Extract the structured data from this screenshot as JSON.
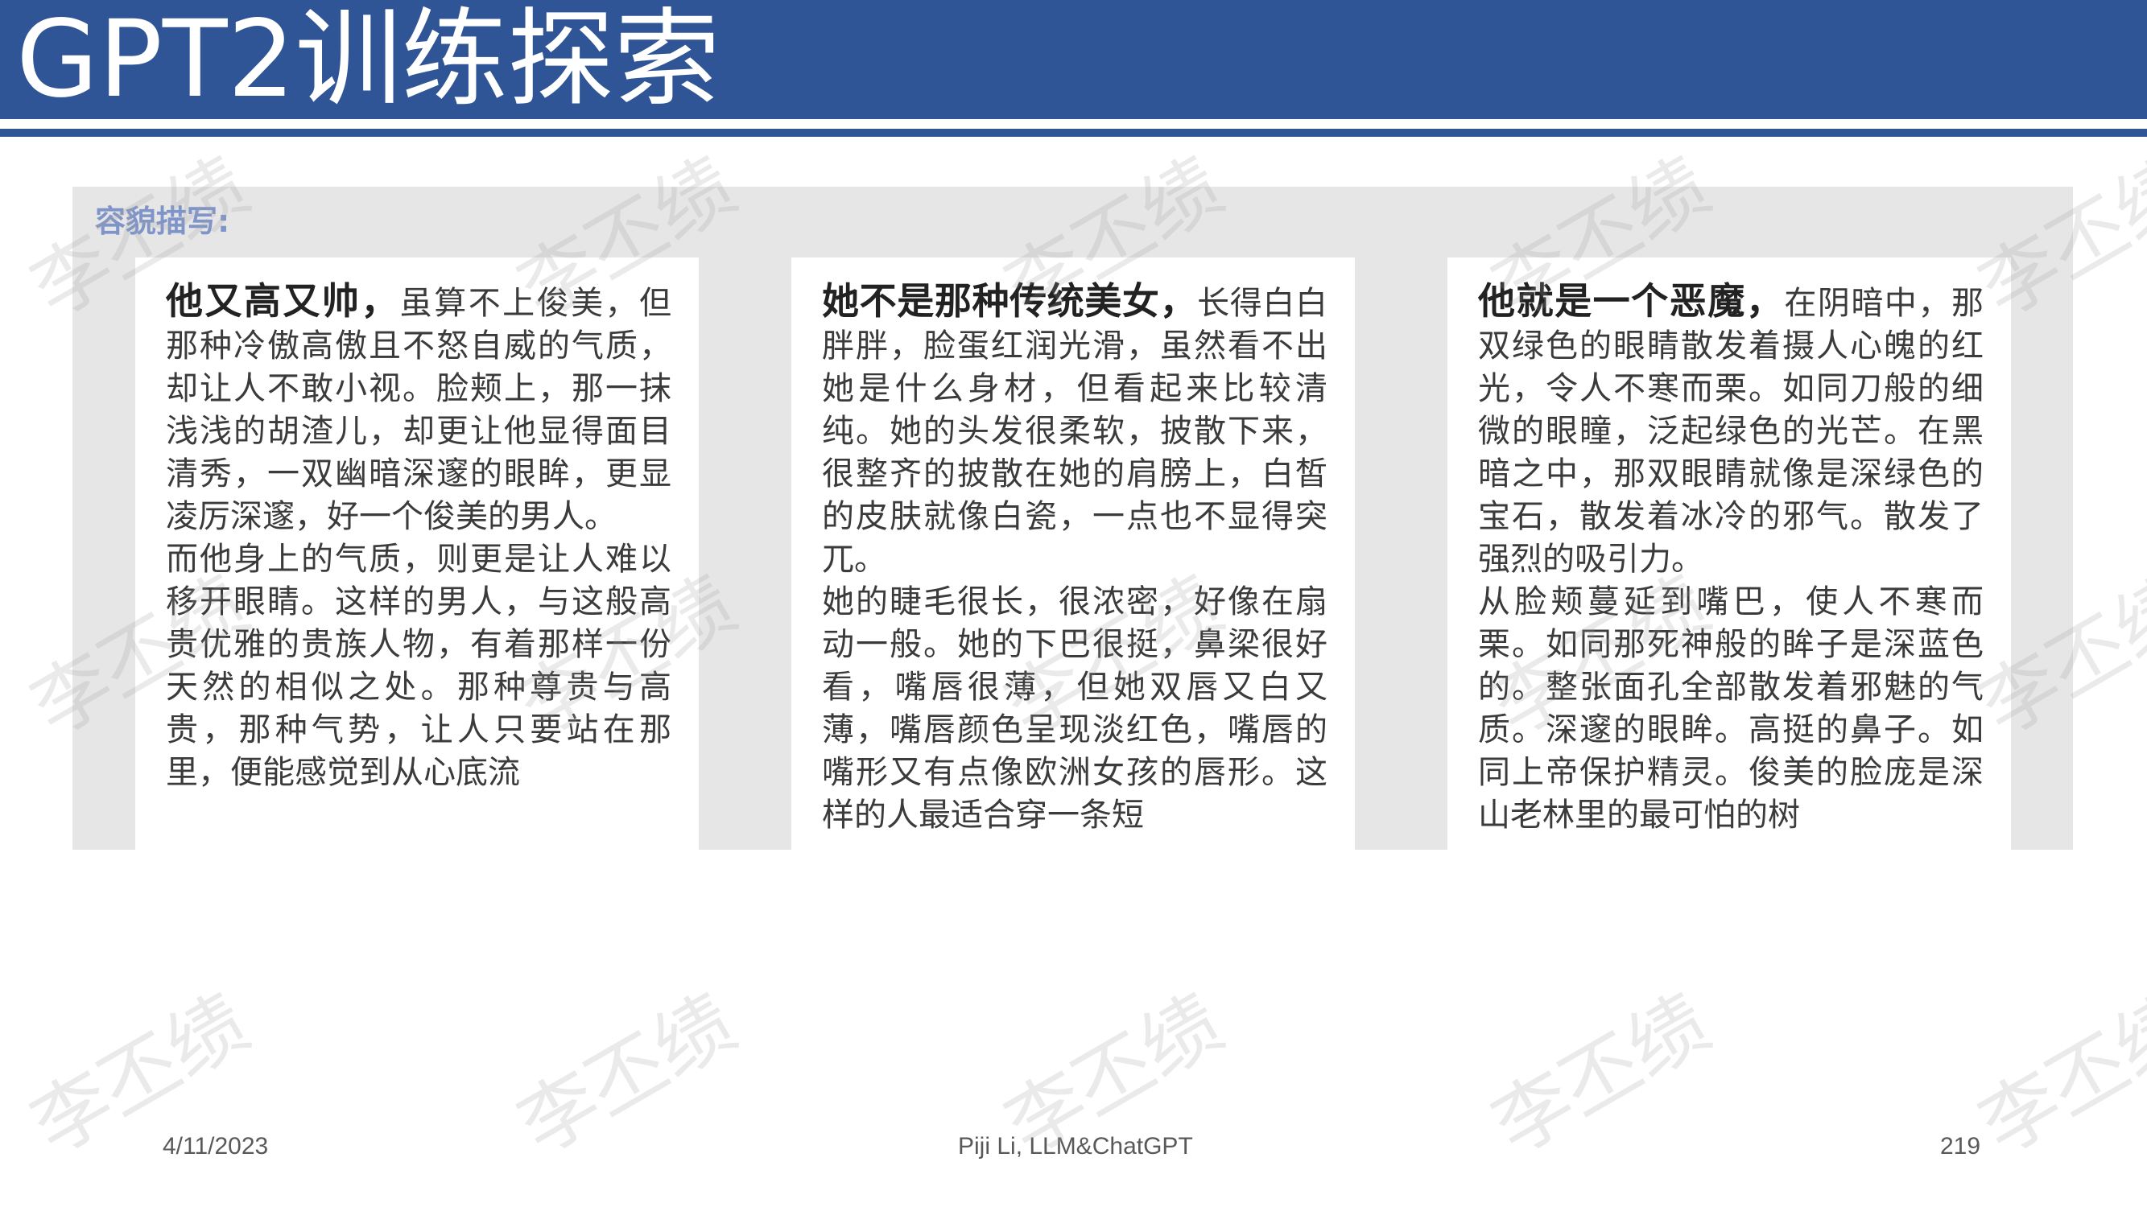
{
  "slide": {
    "title": "GPT2训练探索",
    "figure_label": "容貌描写:",
    "cards": [
      {
        "lead": "他又高又帅，",
        "first": "虽算不上俊美，但那种冷傲高傲且不怒自威的气质，却让人不敢小视。脸颊上，那一抹浅浅的胡渣儿，却更让他显得面目清秀，一双幽暗深邃的眼眸，更显凌厉深邃，好一个俊美的男人。",
        "second": "而他身上的气质，则更是让人难以移开眼睛。这样的男人，与这般高贵优雅的贵族人物，有着那样一份天然的相似之处。那种尊贵与高贵，那种气势，让人只要站在那里，便能感觉到从心底流"
      },
      {
        "lead": "她不是那种传统美女，",
        "first": "长得白白胖胖，脸蛋红润光滑，虽然看不出她是什么身材，但看起来比较清纯。她的头发很柔软，披散下来，很整齐的披散在她的肩膀上，白皙的皮肤就像白瓷，一点也不显得突兀。",
        "second": "她的睫毛很长，很浓密，好像在扇动一般。她的下巴很挺，鼻梁很好看，嘴唇很薄，但她双唇又白又薄，嘴唇颜色呈现淡红色，嘴唇的嘴形又有点像欧洲女孩的唇形。这样的人最适合穿一条短"
      },
      {
        "lead": "他就是一个恶魔，",
        "first": "在阴暗中，那双绿色的眼睛散发着摄人心魄的红光，令人不寒而栗。如同刀般的细微的眼瞳，泛起绿色的光芒。在黑暗之中，那双眼睛就像是深绿色的宝石，散发着冰冷的邪气。散发了强烈的吸引力。",
        "second": "从脸颊蔓延到嘴巴，使人不寒而栗。如同那死神般的眸子是深蓝色的。整张面孔全部散发着邪魅的气质。深邃的眼眸。高挺的鼻子。如同上帝保护精灵。俊美的脸庞是深山老林里的最可怕的树"
      }
    ],
    "footer": {
      "date": "4/11/2023",
      "center": "Piji Li, LLM&ChatGPT",
      "page": "219"
    },
    "watermark": "李丕绩"
  }
}
